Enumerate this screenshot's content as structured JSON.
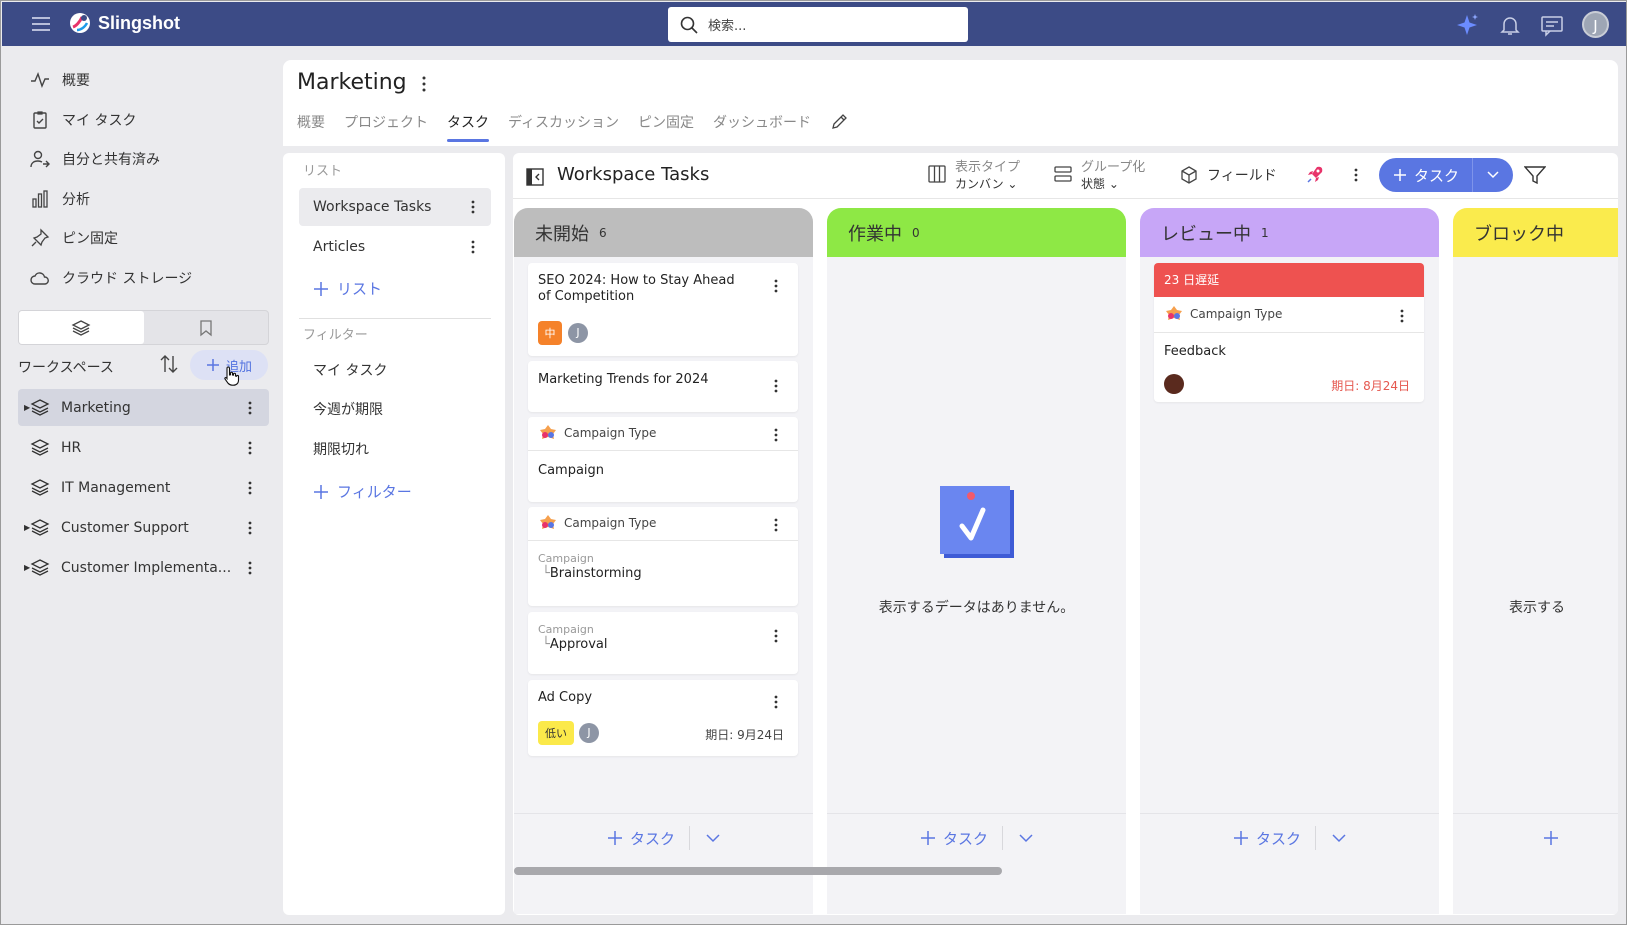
{
  "app": {
    "name": "Slingshot",
    "search_placeholder": "検索...",
    "user_initial": "J"
  },
  "nav": [
    {
      "label": "概要",
      "icon": "activity-icon"
    },
    {
      "label": "マイ タスク",
      "icon": "clipboard-check-icon"
    },
    {
      "label": "自分と共有済み",
      "icon": "user-share-icon"
    },
    {
      "label": "分析",
      "icon": "bar-chart-icon"
    },
    {
      "label": "ピン固定",
      "icon": "pin-icon"
    },
    {
      "label": "クラウド ストレージ",
      "icon": "cloud-icon"
    }
  ],
  "workspaces": {
    "title": "ワークスペース",
    "add_label": "追加",
    "items": [
      {
        "label": "Marketing",
        "expandable": true,
        "selected": true
      },
      {
        "label": "HR",
        "expandable": false
      },
      {
        "label": "IT Management",
        "expandable": false
      },
      {
        "label": "Customer Support",
        "expandable": true
      },
      {
        "label": "Customer Implementa...",
        "expandable": true
      }
    ]
  },
  "page": {
    "title": "Marketing",
    "tabs": [
      "概要",
      "プロジェクト",
      "タスク",
      "ディスカッション",
      "ピン固定",
      "ダッシュボード"
    ],
    "active_tab": "タスク"
  },
  "lists": {
    "section_label": "リスト",
    "items": [
      "Workspace Tasks",
      "Articles"
    ],
    "add_label": "リスト",
    "filters_label": "フィルター",
    "filters": [
      "マイ タスク",
      "今週が期限",
      "期限切れ"
    ],
    "add_filter_label": "フィルター"
  },
  "board": {
    "title": "Workspace Tasks",
    "view_type_label": "表示タイプ",
    "view_type_value": "カンバン",
    "group_label": "グループ化",
    "group_value": "状態",
    "fields_label": "フィールド",
    "new_task_label": "タスク",
    "add_task_label": "タスク",
    "empty_text": "表示するデータはありません。",
    "empty_text_partial": "表示する",
    "columns": [
      {
        "name": "未開始",
        "count": "6",
        "color": "#bdbdbd"
      },
      {
        "name": "作業中",
        "count": "0",
        "color": "#8ee845"
      },
      {
        "name": "レビュー中",
        "count": "1",
        "color": "#c7a6f7"
      },
      {
        "name": "ブロック中",
        "color": "#faeb4d"
      }
    ],
    "cards": {
      "c1": {
        "title": "SEO 2024: How to Stay Ahead of Competition",
        "priority": "中",
        "priority_color": "#f5822a",
        "assignee": "J"
      },
      "c2": {
        "title": "Marketing Trends for 2024"
      },
      "c3": {
        "type": "Campaign Type",
        "title": "Campaign"
      },
      "c4": {
        "type": "Campaign Type",
        "parent": "Campaign",
        "title": "Brainstorming"
      },
      "c5": {
        "parent": "Campaign",
        "title": "Approval"
      },
      "c6": {
        "title": "Ad Copy",
        "priority": "低い",
        "priority_color": "#fbe94a",
        "assignee": "J",
        "due": "期日: 9月24日"
      },
      "r1": {
        "overdue": "23 日遅延",
        "type": "Campaign Type",
        "title": "Feedback",
        "due": "期日: 8月24日"
      }
    }
  }
}
